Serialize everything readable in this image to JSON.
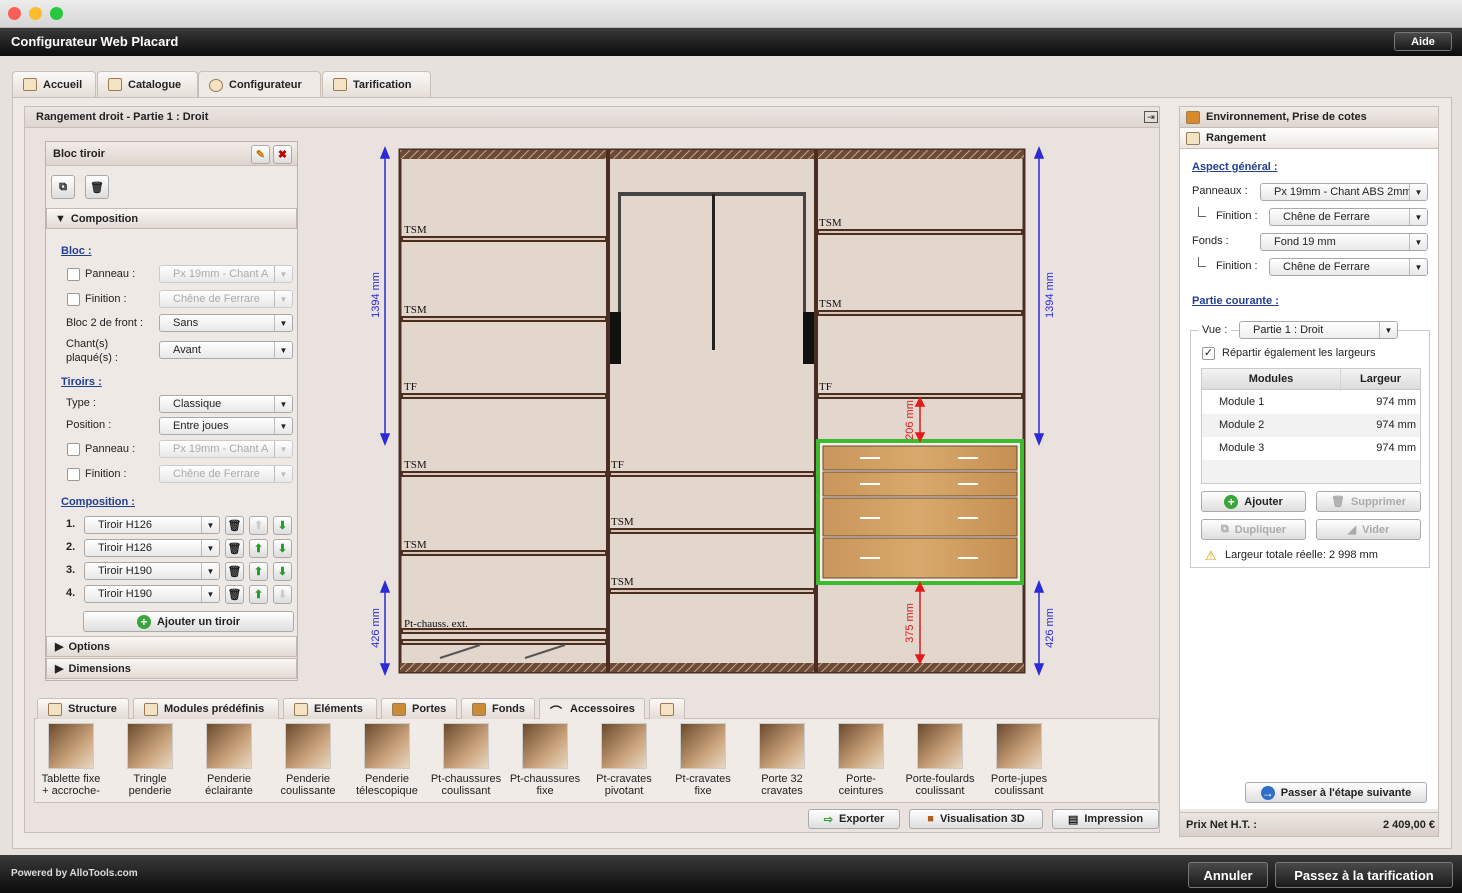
{
  "app": {
    "title": "Configurateur Web Placard",
    "help": "Aide",
    "powered": "Powered by AlloTools.com",
    "cancel": "Annuler",
    "next_pricing": "Passez à la tarification"
  },
  "tabs": [
    {
      "label": "Accueil"
    },
    {
      "label": "Catalogue"
    },
    {
      "label": "Configurateur"
    },
    {
      "label": "Tarification"
    }
  ],
  "main": {
    "title": "Rangement droit - Partie 1 : Droit"
  },
  "bloc_panel": {
    "title": "Bloc tiroir",
    "composition_header": "Composition",
    "bloc_section": "Bloc :",
    "panneau_label": "Panneau :",
    "panneau_value": "Px 19mm - Chant A",
    "finition_label": "Finition :",
    "finition_value": "Chêne de Ferrare",
    "bloc2_label": "Bloc 2 de front :",
    "bloc2_value": "Sans",
    "chant_label1": "Chant(s)",
    "chant_label2": "plaqué(s) :",
    "chant_value": "Avant",
    "tiroirs_section": "Tiroirs :",
    "type_label": "Type :",
    "type_value": "Classique",
    "position_label": "Position :",
    "position_value": "Entre joues",
    "panneau2_label": "Panneau :",
    "panneau2_value": "Px 19mm - Chant A",
    "finition2_label": "Finition :",
    "finition2_value": "Chêne de Ferrare",
    "composition_section": "Composition :",
    "drawers": [
      {
        "num": "1.",
        "value": "Tiroir H126"
      },
      {
        "num": "2.",
        "value": "Tiroir H126"
      },
      {
        "num": "3.",
        "value": "Tiroir H190"
      },
      {
        "num": "4.",
        "value": "Tiroir H190"
      }
    ],
    "add_drawer": "Ajouter un tiroir",
    "options": "Options",
    "dimensions": "Dimensions"
  },
  "drawing": {
    "dim_left_top": "1394 mm",
    "dim_left_bottom": "426 mm",
    "dim_right_top": "1394 mm",
    "dim_right_bottom": "426 mm",
    "dim_red_top": "206 mm",
    "dim_red_bottom": "375 mm",
    "labels": [
      "TSM",
      "TSM",
      "TF",
      "TSM",
      "TSM",
      "Pt-chauss. ext.",
      "TF",
      "TSM",
      "TSM",
      "TSM",
      "TSM",
      "TF"
    ]
  },
  "bottom_tabs": [
    {
      "label": "Structure"
    },
    {
      "label": "Modules prédéfinis"
    },
    {
      "label": "Eléments"
    },
    {
      "label": "Portes"
    },
    {
      "label": "Fonds"
    },
    {
      "label": "Accessoires"
    }
  ],
  "accessories": [
    {
      "l1": "Tablette fixe",
      "l2": "+ accroche-"
    },
    {
      "l1": "Tringle",
      "l2": "penderie"
    },
    {
      "l1": "Penderie",
      "l2": "éclairante"
    },
    {
      "l1": "Penderie",
      "l2": "coulissante"
    },
    {
      "l1": "Penderie",
      "l2": "télescopique"
    },
    {
      "l1": "Pt-chaussures",
      "l2": "coulissant"
    },
    {
      "l1": "Pt-chaussures",
      "l2": "fixe"
    },
    {
      "l1": "Pt-cravates",
      "l2": "pivotant"
    },
    {
      "l1": "Pt-cravates",
      "l2": "fixe"
    },
    {
      "l1": "Porte 32",
      "l2": "cravates"
    },
    {
      "l1": "Porte-",
      "l2": "ceintures"
    },
    {
      "l1": "Porte-foulards",
      "l2": "coulissant"
    },
    {
      "l1": "Porte-jupes",
      "l2": "coulissant"
    }
  ],
  "actions": {
    "export": "Exporter",
    "view3d": "Visualisation 3D",
    "print": "Impression"
  },
  "right": {
    "env_header": "Environnement, Prise de cotes",
    "rangement_header": "Rangement",
    "aspect_section": "Aspect général :",
    "panneaux_label": "Panneaux :",
    "panneaux_value": "Px 19mm - Chant ABS 2mm",
    "finition_label": "Finition :",
    "finition_value": "Chêne de Ferrare",
    "fonds_label": "Fonds :",
    "fonds_value": "Fond 19 mm",
    "finition2_label": "Finition :",
    "finition2_value": "Chêne de Ferrare",
    "partie_section": "Partie courante :",
    "vue_label": "Vue :",
    "vue_value": "Partie 1 : Droit",
    "repartir": "Répartir également les largeurs",
    "table_headers": [
      "Modules",
      "Largeur"
    ],
    "modules": [
      {
        "name": "Module 1",
        "width": "974 mm"
      },
      {
        "name": "Module 2",
        "width": "974 mm"
      },
      {
        "name": "Module 3",
        "width": "974 mm"
      }
    ],
    "add": "Ajouter",
    "delete": "Supprimer",
    "duplicate": "Dupliquer",
    "clear": "Vider",
    "total": "Largeur totale réelle: 2 998 mm",
    "next_step": "Passer à l'étape suivante",
    "price_label": "Prix Net H.T. :",
    "price_value": "2 409,00 €"
  },
  "colors": {
    "accent_blue": "#223f8f",
    "highlight_green": "#3dbb2f",
    "dim_red": "#e11b1b",
    "dim_blue": "#2b2bd6"
  }
}
